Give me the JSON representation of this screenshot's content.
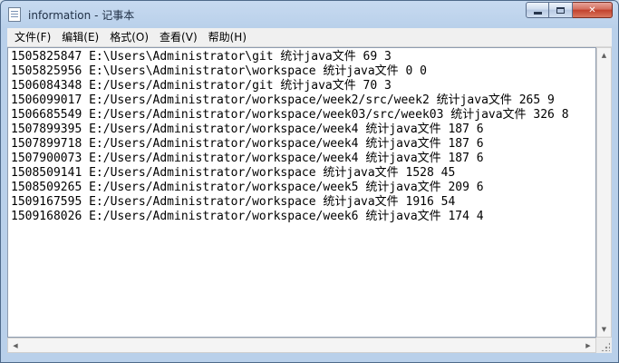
{
  "window": {
    "title": "information - 记事本",
    "caption": {
      "minimize": "",
      "maximize": "",
      "close": "✕"
    }
  },
  "menu": [
    {
      "label": "文件(F)"
    },
    {
      "label": "编辑(E)"
    },
    {
      "label": "格式(O)"
    },
    {
      "label": "查看(V)"
    },
    {
      "label": "帮助(H)"
    }
  ],
  "content": {
    "lines": [
      "1505825847 E:\\Users\\Administrator\\git 统计java文件 69 3",
      "1505825956 E:\\Users\\Administrator\\workspace 统计java文件 0 0",
      "1506084348 E:/Users/Administrator/git 统计java文件 70 3",
      "1506099017 E:/Users/Administrator/workspace/week2/src/week2 统计java文件 265 9",
      "1506685549 E:/Users/Administrator/workspace/week03/src/week03 统计java文件 326 8",
      "1507899395 E:/Users/Administrator/workspace/week4 统计java文件 187 6",
      "1507899718 E:/Users/Administrator/workspace/week4 统计java文件 187 6",
      "1507900073 E:/Users/Administrator/workspace/week4 统计java文件 187 6",
      "1508509141 E:/Users/Administrator/workspace 统计java文件 1528 45",
      "1508509265 E:/Users/Administrator/workspace/week5 统计java文件 209 6",
      "1509167595 E:/Users/Administrator/workspace 统计java文件 1916 54",
      "1509168026 E:/Users/Administrator/workspace/week6 统计java文件 174 4"
    ]
  },
  "scrollbars": {
    "up_arrow": "▲",
    "down_arrow": "▼",
    "left_arrow": "◀",
    "right_arrow": "▶"
  }
}
